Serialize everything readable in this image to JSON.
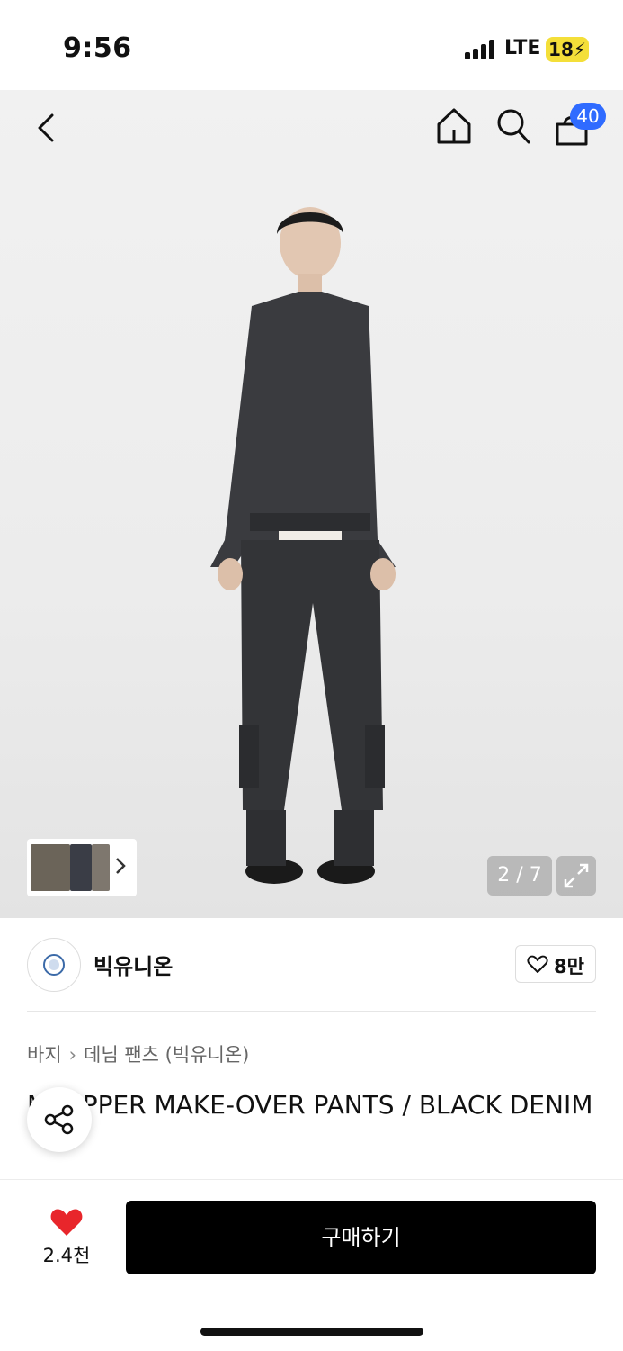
{
  "status_bar": {
    "time": "9:56",
    "network": "LTE",
    "battery": "18"
  },
  "header": {
    "cart_count": "40",
    "icons": [
      "back-icon",
      "home-icon",
      "search-icon",
      "shopping-bag-icon"
    ]
  },
  "gallery": {
    "pager": "2 / 7"
  },
  "brand": {
    "name": "빅유니온",
    "likes": "8만"
  },
  "breadcrumb": {
    "category": "바지",
    "subcategory": "데님 팬츠 (빅유니온)"
  },
  "product": {
    "title": "M-ZIPPER MAKE-OVER PANTS / BLACK DENIM"
  },
  "bottom_bar": {
    "favorites": "2.4천",
    "buy_label": "구매하기"
  },
  "colors": {
    "accent": "#2f6bff",
    "favorite": "#e8262b",
    "buy_button": "#000000"
  }
}
